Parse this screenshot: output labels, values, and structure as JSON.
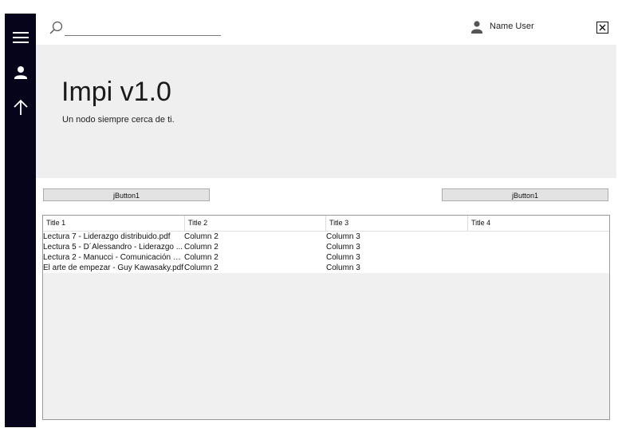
{
  "search": {
    "value": "",
    "placeholder": ""
  },
  "user": {
    "name": "Name User"
  },
  "hero": {
    "title": "Impi v1.0",
    "subtitle": "Un nodo siempre cerca de ti."
  },
  "buttons": {
    "left_label": "jButton1",
    "right_label": "jButton1"
  },
  "table": {
    "headers": [
      "Title 1",
      "Title 2",
      "Title 3",
      "Title 4"
    ],
    "rows": [
      [
        "Lectura 7 - Liderazgo distribuido.pdf",
        "Column 2",
        "Column 3",
        ""
      ],
      [
        "Lectura 5 - D´Alessandro - Liderazgo ...",
        "Column 2",
        "Column 3",
        ""
      ],
      [
        "Lectura 2 - Manucci - Comunicación - i...",
        "Column 2",
        "Column 3",
        ""
      ],
      [
        "El arte de empezar - Guy Kawasaky.pdf",
        "Column 2",
        "Column 3",
        ""
      ]
    ]
  },
  "icons": {
    "sidebar": [
      "hamburger-menu-icon",
      "user-icon",
      "arrow-up-icon"
    ],
    "topbar": [
      "search-icon",
      "user-icon",
      "close-icon"
    ]
  },
  "colors": {
    "sidebar": "#05041a",
    "hero_background": "#efefef",
    "button_background": "#e3e3e3"
  }
}
